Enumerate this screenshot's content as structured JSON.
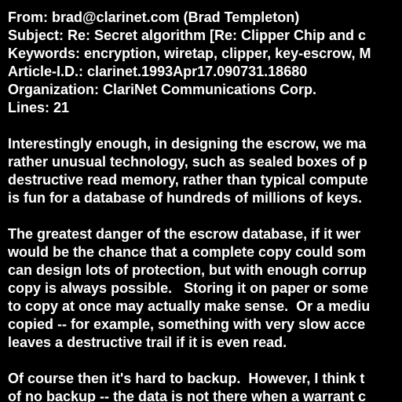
{
  "colors": {
    "background": "#000000",
    "text": "#ffffff"
  },
  "header": {
    "from": "From: brad@clarinet.com (Brad Templeton)",
    "subject": "Subject: Re: Secret algorithm [Re: Clipper Chip and c",
    "keywords": "Keywords: encryption, wiretap, clipper, key-escrow, M",
    "article_id": "Article-I.D.: clarinet.1993Apr17.090731.18680",
    "organization": "Organization: ClariNet Communications Corp.",
    "lines": "Lines: 21"
  },
  "body": {
    "paragraph_1": [
      "Interestingly enough, in designing the escrow, we ma",
      "rather unusual technology, such as sealed boxes of p",
      "destructive read memory, rather than typical compute",
      "is fun for a database of hundreds of millions of keys."
    ],
    "paragraph_2": [
      "The greatest danger of the escrow database, if it wer",
      "would be the chance that a complete copy could som",
      "can design lots of protection, but with enough corrup",
      "copy is always possible.   Storing it on paper or some",
      "to copy at once may actually make sense.  Or a mediu",
      "copied -- for example, something with very slow acce",
      "leaves a destructive trail if it is even read."
    ],
    "paragraph_3": [
      "Of course then it's hard to backup.  However, I think t",
      "of no backup -- the data is not there when a warrant c"
    ]
  }
}
